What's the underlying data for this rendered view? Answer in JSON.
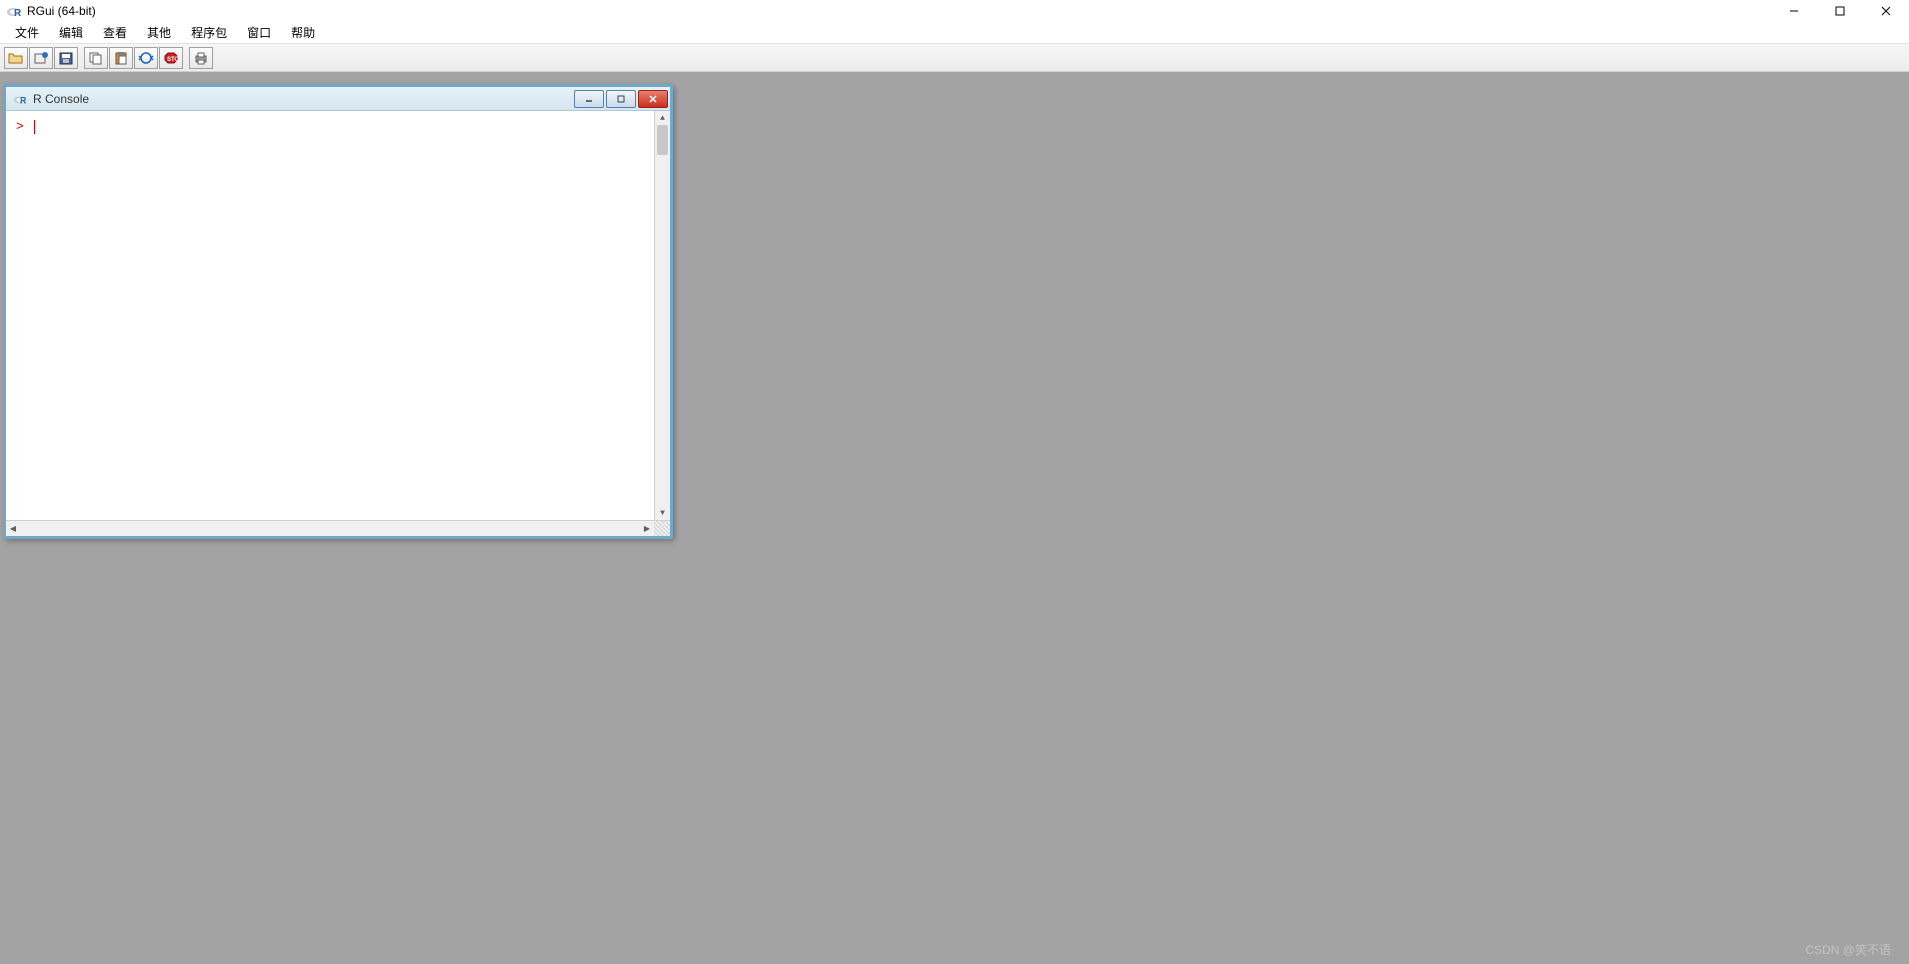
{
  "main_window": {
    "title": "RGui (64-bit)"
  },
  "menu": {
    "file": "文件",
    "edit": "编辑",
    "view": "查看",
    "misc": "其他",
    "packages": "程序包",
    "windows": "窗口",
    "help": "帮助"
  },
  "toolbar_icons": {
    "open": "open-icon",
    "load_workspace": "load-workspace-icon",
    "save": "save-icon",
    "copy": "copy-icon",
    "paste": "paste-icon",
    "copy_paste": "copy-paste-icon",
    "stop": "stop-icon",
    "print": "print-icon"
  },
  "console": {
    "title": "R Console",
    "prompt": ">"
  },
  "watermark": "CSDN @笑不语"
}
